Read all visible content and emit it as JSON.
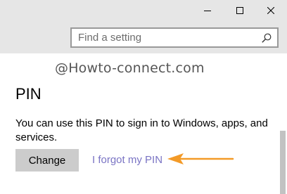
{
  "window": {
    "controls": {
      "minimize": "minimize-icon",
      "maximize": "maximize-icon",
      "close": "close-icon"
    }
  },
  "search": {
    "placeholder": "Find a setting",
    "icon": "search-icon"
  },
  "watermark": "@Howto-connect.com",
  "section": {
    "title": "PIN",
    "description": "You can use this PIN to sign in to Windows, apps, and services.",
    "change_label": "Change",
    "forgot_link": "I forgot my PIN"
  },
  "colors": {
    "arrow": "#f39a27",
    "link": "#7a74c4",
    "titlebar": "#e6e6e6",
    "button": "#cccccc"
  }
}
